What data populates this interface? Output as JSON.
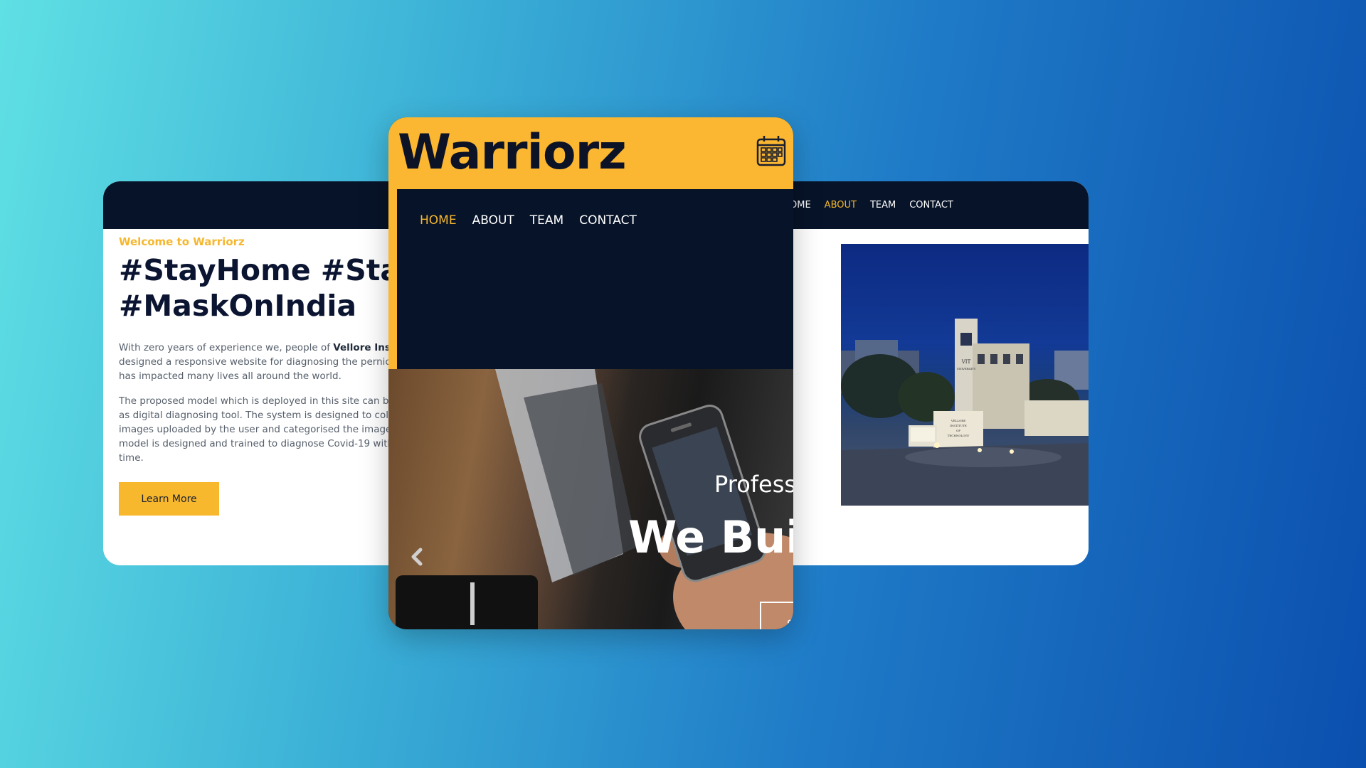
{
  "left_card": {
    "welcome": "Welcome to Warriorz",
    "headline_line1": "#StayHome #Sta",
    "headline_line2": "#MaskOnIndia",
    "para1_line1_pre": "With zero years of experience we, people of ",
    "para1_line1_bold": "Vellore Institu",
    "para1_line2": "designed a responsive website for diagnosing the pernici",
    "para1_line3": "has impacted many lives all around the world.",
    "para2_line1": "The proposed model which is deployed in this site can be",
    "para2_line2": "as digital diagnosing tool. The system is designed to colle",
    "para2_line3": "images uploaded by the user and categorised the image",
    "para2_line4": "model is designed and trained to diagnose Covid-19 with",
    "para2_line5": "time.",
    "cta": "Learn More"
  },
  "center_card": {
    "brand": "Warriorz",
    "nav": [
      "HOME",
      "ABOUT",
      "TEAM",
      "CONTACT"
    ],
    "active_nav": "HOME",
    "hero_subtitle": "Profess",
    "hero_title": "We Bui",
    "hero_button": "S",
    "icons": {
      "calendar": "calendar-icon",
      "prev": "chevron-left-icon"
    }
  },
  "right_card": {
    "nav": [
      "OME",
      "ABOUT",
      "TEAM",
      "CONTACT"
    ],
    "active_nav": "ABOUT",
    "photo_sign_lines": [
      "VIT",
      "UNIVERSITY",
      "VELLORE",
      "INSTITUTE",
      "OF",
      "TECHNOLOGY"
    ]
  },
  "colors": {
    "accent": "#f6b72e",
    "navy": "#071328",
    "brand_bar": "#fbb731"
  }
}
